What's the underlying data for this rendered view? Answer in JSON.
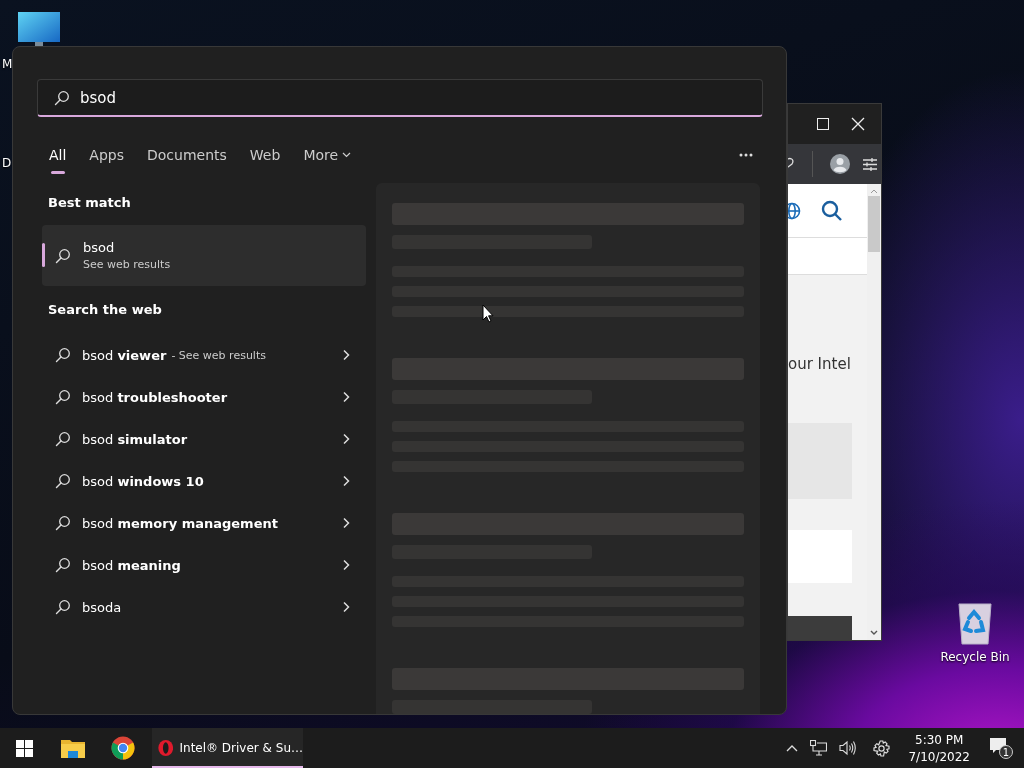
{
  "desktop_icons": [
    {
      "icon": true,
      "label": "M"
    },
    {
      "label": "D"
    }
  ],
  "recycle_bin": {
    "label": "Recycle Bin"
  },
  "browser_window": {
    "page_text": "our Intel"
  },
  "start_menu": {
    "search": {
      "value": "bsod"
    },
    "tabs": [
      {
        "label": "All",
        "selected": true
      },
      {
        "label": "Apps",
        "selected": false
      },
      {
        "label": "Documents",
        "selected": false
      },
      {
        "label": "Web",
        "selected": false
      },
      {
        "label": "More",
        "selected": false,
        "dropdown": true
      }
    ],
    "best_match": {
      "heading": "Best match",
      "title": "bsod",
      "subtitle": "See web results",
      "selected": true
    },
    "web": {
      "heading": "Search the web",
      "items": [
        {
          "text": "bsod **viewer**",
          "suffix": "- See web results"
        },
        {
          "text": "bsod **troubleshooter**"
        },
        {
          "text": "bsod **simulator**"
        },
        {
          "text": "bsod **windows 10**"
        },
        {
          "text": "bsod **memory management**"
        },
        {
          "text": "bsod **meaning**"
        },
        {
          "text": "bsoda"
        }
      ]
    },
    "preview": {
      "loading": true
    }
  },
  "taskbar": {
    "apps": [
      {
        "kind": "start"
      },
      {
        "kind": "folder"
      },
      {
        "kind": "chrome"
      },
      {
        "kind": "opera",
        "label": "Intel® Driver & Su…",
        "active": true
      }
    ],
    "clock": {
      "time": "5:30 PM",
      "date": "7/10/2022"
    },
    "notifications": {
      "count": "1"
    }
  }
}
